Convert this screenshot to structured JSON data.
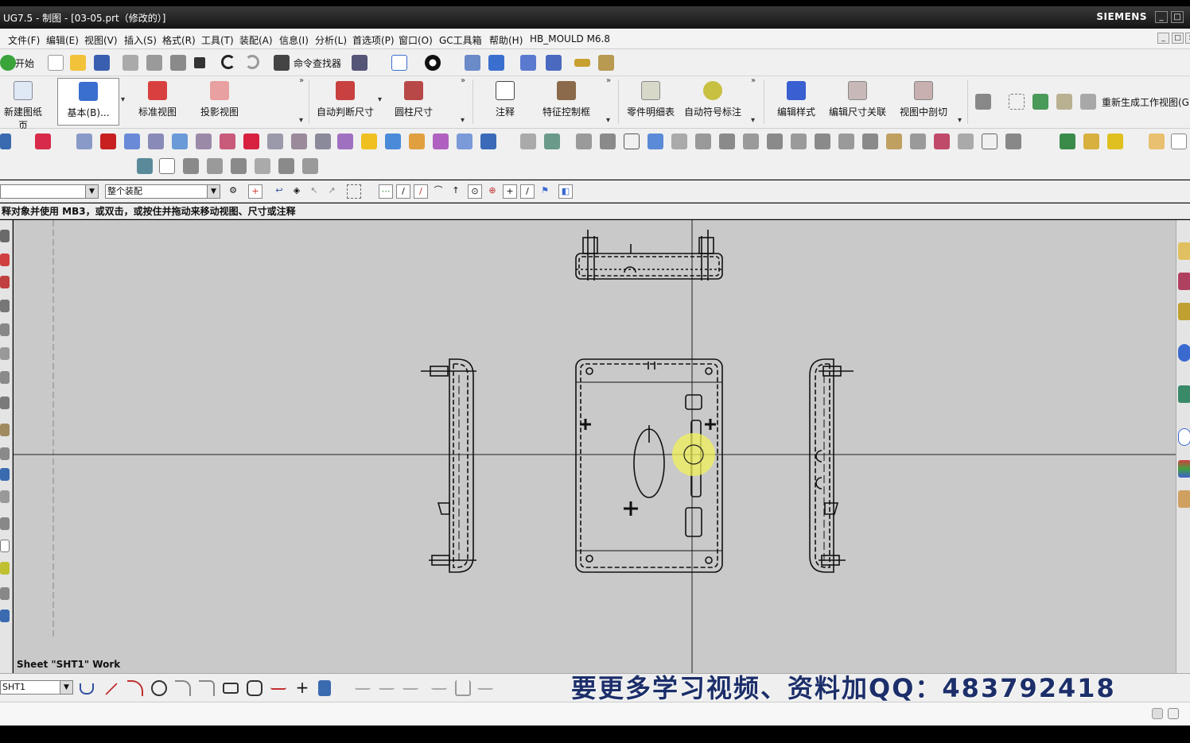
{
  "window": {
    "title": "UG7.5 - 制图 - [03-05.prt（修改的）]",
    "brand": "SIEMENS",
    "minimize_glyph": "_",
    "maximize_glyph": "□",
    "close_glyph": "×"
  },
  "menu": [
    "文件(F)",
    "编辑(E)",
    "视图(V)",
    "插入(S)",
    "格式(R)",
    "工具(T)",
    "装配(A)",
    "信息(I)",
    "分析(L)",
    "首选项(P)",
    "窗口(O)",
    "GC工具箱",
    "帮助(H)",
    "HB_MOULD M6.8"
  ],
  "toolbar1": {
    "start_label": "开始",
    "command_finder_label": "命令查找器"
  },
  "ribbon": {
    "new_sheet": "新建图纸页",
    "base_view": "基本(B)...",
    "standard_view": "标准视图",
    "projected_view": "投影视图",
    "auto_dimension": "自动判断尺寸",
    "cylinder_dimension": "圆柱尺寸",
    "note": "注释",
    "feature_control_frame": "特征控制框",
    "parts_list": "零件明细表",
    "auto_balloon": "自动符号标注",
    "edit_style": "编辑样式",
    "edit_dimension_association": "编辑尺寸关联",
    "section_in_view": "视图中剖切",
    "regenerate_work_view": "重新生成工作视图(G)"
  },
  "selection_bar": {
    "filter_value": "",
    "scope_value": "整个装配"
  },
  "cue_line": "释对象并使用 MB3，或双击，或按住并拖动来移动视图、尺寸或注释",
  "canvas": {
    "sheet_label": "Sheet \"SHT1\" Work"
  },
  "sketch_bar": {
    "sheet_combo_value": "SHT1"
  },
  "watermark": "要更多学习视频、资料加QQ：483792418",
  "icons": [
    "start-icon",
    "new-file-icon",
    "open-icon",
    "save-icon",
    "cut-icon",
    "copy-icon",
    "paste-icon",
    "delete-icon",
    "undo-icon",
    "redo-icon",
    "binoculars-icon",
    "close-icon"
  ]
}
